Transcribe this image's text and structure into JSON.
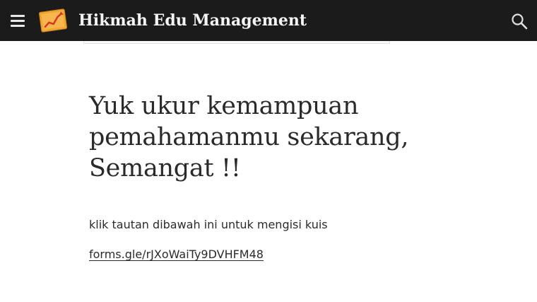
{
  "header": {
    "site_title": "Hikmah Edu Management",
    "menu_icon": "menu-icon",
    "logo_icon": "chart-board-logo",
    "search_icon": "search-icon"
  },
  "post": {
    "heading_line1": "Yuk ukur kemampuan",
    "heading_line2": "pemahamanmu sekarang,",
    "heading_line3": "Semangat !!",
    "instruction": "klik tautan dibawah ini untuk mengisi kuis",
    "link_text": "forms.gle/rJXoWaiTy9DVHFM48"
  },
  "colors": {
    "header_bg": "#1b1b1b",
    "logo_orange": "#f3a632",
    "text": "#2a2a2a"
  }
}
